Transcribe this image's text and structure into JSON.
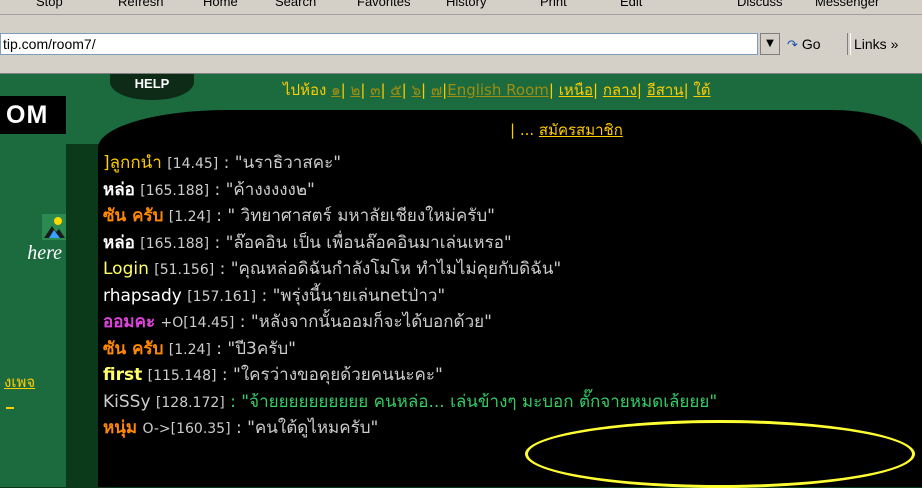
{
  "toolbar": {
    "items": [
      "Stop",
      "Refresh",
      "Home",
      "Search",
      "Favorites",
      "History",
      "Print",
      "Edit",
      "Discuss",
      "Messenger"
    ]
  },
  "addressbar": {
    "url": "tip.com/room7/",
    "go_label": "Go",
    "links_label": "Links »"
  },
  "leftpanel": {
    "logo_text": "OM",
    "here_text": "here",
    "link_text": "งเพจ"
  },
  "nav": {
    "help_label": "HELP",
    "goto_label": "ไปห้อง",
    "rooms": [
      "๑",
      "๒",
      "๓",
      "๕",
      "๖",
      "๗"
    ],
    "english_room": "English Room",
    "regions": [
      "เหนือ",
      "กลาง",
      "อีสาน",
      "ใต้"
    ],
    "separator": "|",
    "line2_prefix": "| ...",
    "register": "สมัครสมาชิก"
  },
  "messages": [
    {
      "nick": "]ลูกกนำ",
      "ip": "[14.45]",
      "text": " : \"นราธิวาสคะ\"",
      "color": "#ffcc00"
    },
    {
      "nick": "หล่อ",
      "ip": "[165.188]",
      "text": " : \"ค้างงงงง๒\"",
      "color": "#ffffff"
    },
    {
      "nick": "ซัน ครับ",
      "ip": "[1.24]",
      "text": " : \" วิทยาศาสตร์ มหาลัยเชียงใหม่ครับ\"",
      "color": "#ff8800"
    },
    {
      "nick": "หล่อ",
      "ip": "[165.188]",
      "text": " : \"ล๊อคอิน เป็น เพื่อนล๊อคอินมาเล่นเหรอ\"",
      "color": "#ffffff"
    },
    {
      "nick": "Login",
      "ip": "[51.156]",
      "text": " : \"คุณหล่อดิฉันกำลังโมโห ทำไมไม่คุยกับดิฉัน\"",
      "color": "#ffff66"
    },
    {
      "nick": "rhapsady",
      "ip": "[157.161]",
      "text": " : \"พรุ่งนี้นายเล่นnetป่าว\"",
      "color": "#ffffff"
    },
    {
      "nick": "ออมคะ",
      "ip": "+O[14.45]",
      "text": " : \"หลังจากนั้นออมก็จะได้บอกด้วย\"",
      "color": "#dd44dd"
    },
    {
      "nick": "ซัน ครับ",
      "ip": "[1.24]",
      "text": " : \"ปี3ครับ\"",
      "color": "#ff8800"
    },
    {
      "nick": "first",
      "ip": "[115.148]",
      "text": " : \"ใครว่างขอคุยด้วยคนนะคะ\"",
      "color": "#ffff66"
    },
    {
      "nick": "KiSSy",
      "ip": "[128.172]",
      "text": " : \"จ้ายยยยยยยยยย คนหล่อ... เล่นข้างๆ มะบอก ตั๊กจายหมดเล้ยยย\"",
      "color": "#cccccc",
      "text_color": "#33cc66"
    },
    {
      "nick": "หนุ่ม",
      "ip": "O->[160.35]",
      "text": " : \"คนใต้ดูไหมครับ\"",
      "color": "#ff8800"
    }
  ],
  "colors": {
    "accent_yellow": "#ffcc00",
    "panel_green": "#1b6b3f",
    "annotation": "#ffff33"
  }
}
